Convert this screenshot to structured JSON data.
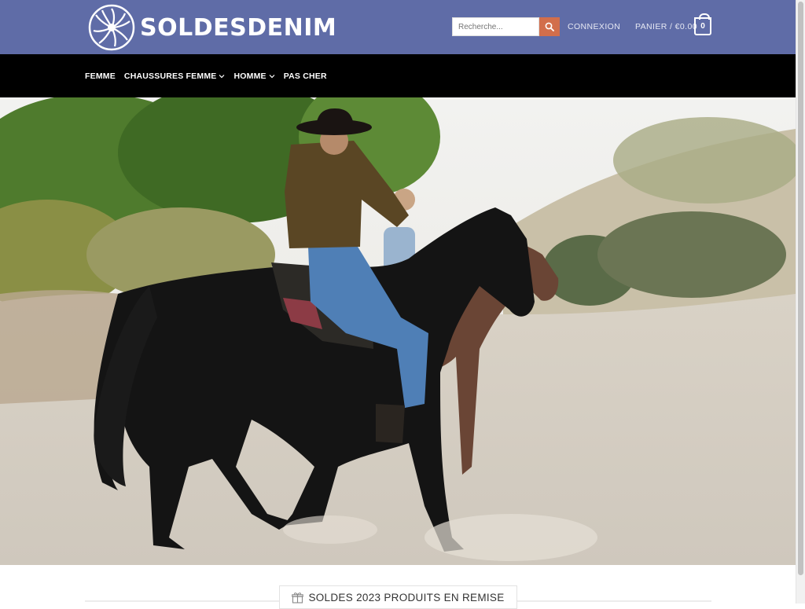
{
  "brand": {
    "name": "SOLDESDENIM",
    "color": "#5f6ca7"
  },
  "header": {
    "search": {
      "placeholder": "Recherche...",
      "value": "",
      "icon": "search-icon"
    },
    "login_label": "CONNEXION",
    "cart": {
      "label": "PANIER / €0.00",
      "count": "0",
      "icon": "cart-bag-icon"
    }
  },
  "nav": {
    "items": [
      {
        "label": "FEMME",
        "dropdown": false
      },
      {
        "label": "CHAUSSURES FEMME",
        "dropdown": true
      },
      {
        "label": "HOMME",
        "dropdown": true
      },
      {
        "label": "PAS CHER",
        "dropdown": false
      }
    ]
  },
  "hero": {
    "image": "cowboy-riding-horse-photo"
  },
  "section": {
    "title": "SOLDES 2023 PRODUITS EN REMISE",
    "icon": "gift-icon"
  },
  "colors": {
    "accent": "#d26e4b",
    "nav_bg": "#000000",
    "header_bg": "#5f6ca7"
  }
}
